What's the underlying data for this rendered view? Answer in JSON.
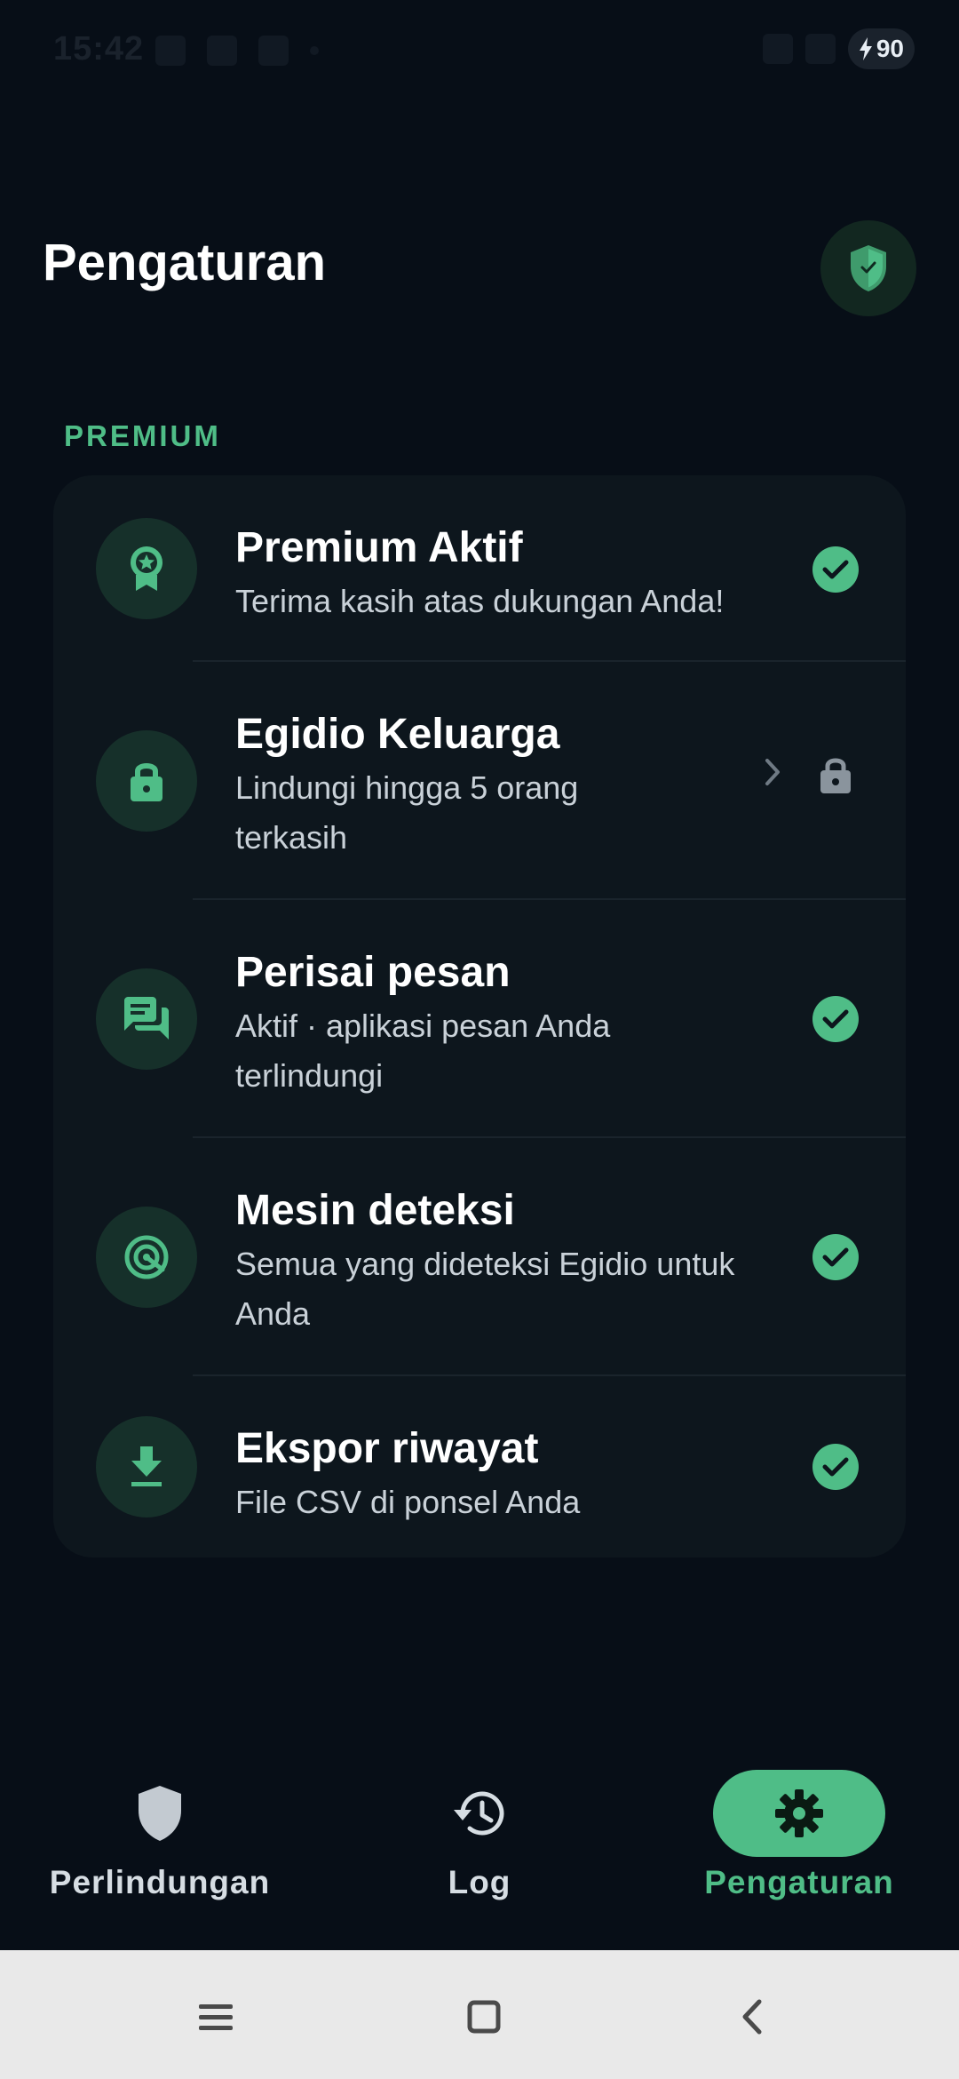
{
  "status_bar": {
    "time": "15:42",
    "battery": "90"
  },
  "header": {
    "title": "Pengaturan"
  },
  "sections": [
    {
      "label": "PREMIUM",
      "items": [
        {
          "title": "Premium Aktif",
          "subtitle": "Terima kasih atas dukungan Anda!",
          "icon": "badge-icon",
          "status": "check"
        },
        {
          "title": "Egidio Keluarga",
          "subtitle": "Lindungi hingga 5 orang terkasih",
          "icon": "lock-icon",
          "status": "locked"
        },
        {
          "title": "Perisai pesan",
          "subtitle": "Aktif · aplikasi pesan Anda terlindungi",
          "icon": "chat-icon",
          "status": "check"
        },
        {
          "title": "Mesin deteksi",
          "subtitle": "Semua yang dideteksi Egidio untuk Anda",
          "icon": "target-icon",
          "status": "check"
        },
        {
          "title": "Ekspor riwayat",
          "subtitle": "File CSV di ponsel Anda",
          "icon": "download-icon",
          "status": "check"
        }
      ]
    }
  ],
  "bottom_nav": {
    "items": [
      {
        "label": "Perlindungan",
        "icon": "shield-icon",
        "active": false
      },
      {
        "label": "Log",
        "icon": "history-icon",
        "active": false
      },
      {
        "label": "Pengaturan",
        "icon": "gear-icon",
        "active": true
      }
    ]
  },
  "system_nav": {
    "buttons": [
      "menu-icon",
      "home-square-icon",
      "back-icon"
    ]
  },
  "colors": {
    "background": "#070e17",
    "card": "#0d161d",
    "accent": "#4fbd87",
    "icon_circle": "#16302a",
    "text_secondary": "#c9d1d8"
  }
}
